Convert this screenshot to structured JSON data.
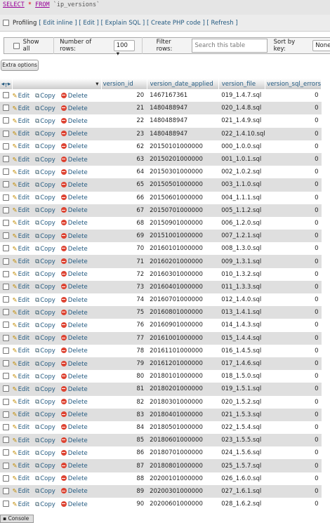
{
  "sql": {
    "select": "SELECT",
    "star": "*",
    "from": "FROM",
    "table": "`ip_versions`"
  },
  "profiling": {
    "label": "Profiling",
    "links": [
      "[ Edit inline ]",
      "[ Edit ]",
      "[ Explain SQL ]",
      "[ Create PHP code ]",
      "[ Refresh ]"
    ]
  },
  "nav": {
    "show_all": "Show all",
    "rows_label": "Number of rows:",
    "rows_value": "100",
    "filter_label": "Filter rows:",
    "search_placeholder": "Search this table",
    "sort_label": "Sort by key:",
    "sort_value": "None"
  },
  "extra_options": "Extra options",
  "columns": [
    "version_id",
    "version_date_applied",
    "version_file",
    "version_sql_errors"
  ],
  "actions": {
    "edit": "Edit",
    "copy": "Copy",
    "delete": "Delete"
  },
  "rows": [
    [
      "20",
      "1467167361",
      "019_1.4.7.sql",
      "0"
    ],
    [
      "21",
      "1480488947",
      "020_1.4.8.sql",
      "0"
    ],
    [
      "22",
      "1480488947",
      "021_1.4.9.sql",
      "0"
    ],
    [
      "23",
      "1480488947",
      "022_1.4.10.sql",
      "0"
    ],
    [
      "62",
      "20150101000000",
      "000_1.0.0.sql",
      "0"
    ],
    [
      "63",
      "20150201000000",
      "001_1.0.1.sql",
      "0"
    ],
    [
      "64",
      "20150301000000",
      "002_1.0.2.sql",
      "0"
    ],
    [
      "65",
      "20150501000000",
      "003_1.1.0.sql",
      "0"
    ],
    [
      "66",
      "20150601000000",
      "004_1.1.1.sql",
      "0"
    ],
    [
      "67",
      "20150701000000",
      "005_1.1.2.sql",
      "0"
    ],
    [
      "68",
      "20150901000000",
      "006_1.2.0.sql",
      "0"
    ],
    [
      "69",
      "20151001000000",
      "007_1.2.1.sql",
      "0"
    ],
    [
      "70",
      "20160101000000",
      "008_1.3.0.sql",
      "0"
    ],
    [
      "71",
      "20160201000000",
      "009_1.3.1.sql",
      "0"
    ],
    [
      "72",
      "20160301000000",
      "010_1.3.2.sql",
      "0"
    ],
    [
      "73",
      "20160401000000",
      "011_1.3.3.sql",
      "0"
    ],
    [
      "74",
      "20160701000000",
      "012_1.4.0.sql",
      "0"
    ],
    [
      "75",
      "20160801000000",
      "013_1.4.1.sql",
      "0"
    ],
    [
      "76",
      "20160901000000",
      "014_1.4.3.sql",
      "0"
    ],
    [
      "77",
      "20161001000000",
      "015_1.4.4.sql",
      "0"
    ],
    [
      "78",
      "20161101000000",
      "016_1.4.5.sql",
      "0"
    ],
    [
      "79",
      "20161201000000",
      "017_1.4.6.sql",
      "0"
    ],
    [
      "80",
      "20180101000000",
      "018_1.5.0.sql",
      "0"
    ],
    [
      "81",
      "20180201000000",
      "019_1.5.1.sql",
      "0"
    ],
    [
      "82",
      "20180301000000",
      "020_1.5.2.sql",
      "0"
    ],
    [
      "83",
      "20180401000000",
      "021_1.5.3.sql",
      "0"
    ],
    [
      "84",
      "20180501000000",
      "022_1.5.4.sql",
      "0"
    ],
    [
      "85",
      "20180601000000",
      "023_1.5.5.sql",
      "0"
    ],
    [
      "86",
      "20180701000000",
      "024_1.5.6.sql",
      "0"
    ],
    [
      "87",
      "20180801000000",
      "025_1.5.7.sql",
      "0"
    ],
    [
      "88",
      "20200101000000",
      "026_1.6.0.sql",
      "0"
    ],
    [
      "89",
      "20200301000000",
      "027_1.6.1.sql",
      "0"
    ],
    [
      "90",
      "20200601000000",
      "028_1.6.2.sql",
      "0"
    ]
  ],
  "console_label": "Console"
}
